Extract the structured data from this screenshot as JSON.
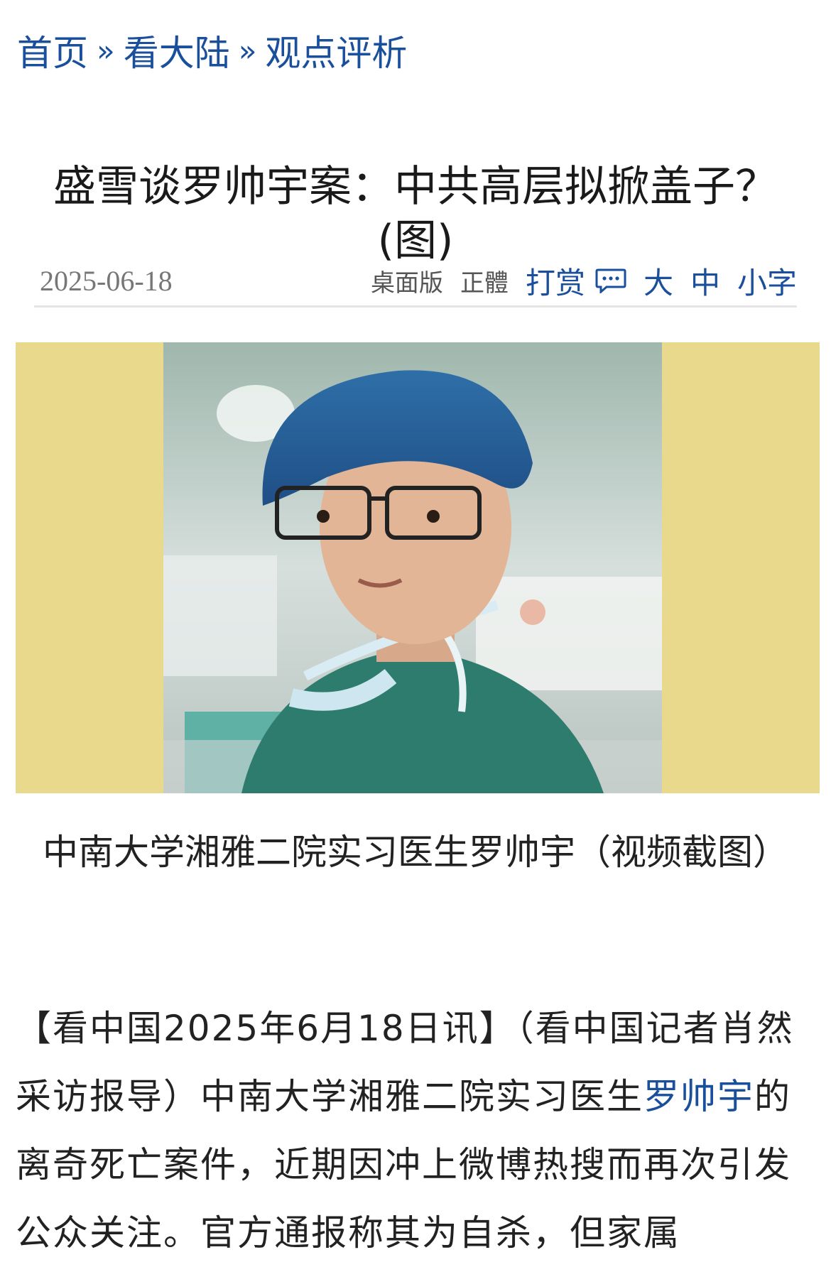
{
  "breadcrumb": {
    "home": "首页",
    "sep": "»",
    "section": "看大陆",
    "subsection": "观点评析"
  },
  "article": {
    "title": "盛雪谈罗帅宇案：中共高层拟掀盖子？(图)",
    "date": "2025-06-18"
  },
  "toolbar": {
    "desktop": "桌面版",
    "traditional": "正體",
    "tip": "打赏",
    "size_large": "大",
    "size_medium": "中",
    "size_small": "小字"
  },
  "photo": {
    "caption": "中南大学湘雅二院实习医生罗帅宇（视频截图）"
  },
  "body": {
    "prefix": "【看中国2025年6月18日讯】（看中国记者肖然采访报导）中南大学湘雅二院实习医生",
    "link_text": "罗帅宇",
    "suffix": "的离奇死亡案件，近期因冲上微博热搜而再次引发公众关注。官方通报称其为自杀，但家属"
  },
  "colors": {
    "accent": "#1a4f9c",
    "photo_bg": "#e8d98c"
  }
}
